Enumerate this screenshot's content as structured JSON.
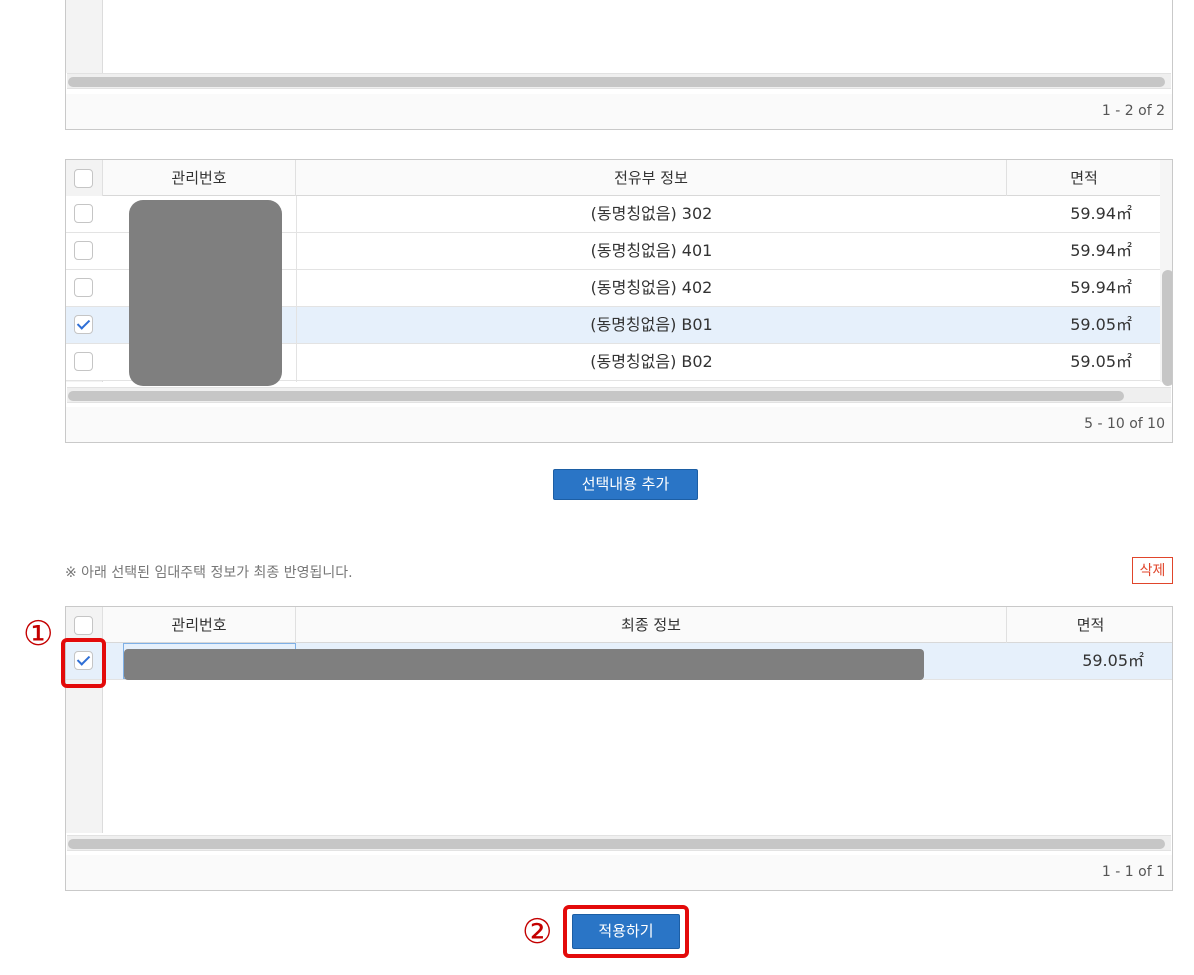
{
  "grid1": {
    "pager": "1 - 2 of 2"
  },
  "grid2": {
    "headers": {
      "id": "관리번호",
      "info": "전유부 정보",
      "area": "면적"
    },
    "rows": [
      {
        "info": "(동명칭없음) 302",
        "area": "59.94㎡",
        "checked": false
      },
      {
        "info": "(동명칭없음) 401",
        "area": "59.94㎡",
        "checked": false
      },
      {
        "info": "(동명칭없음) 402",
        "area": "59.94㎡",
        "checked": false
      },
      {
        "info": "(동명칭없음) B01",
        "area": "59.05㎡",
        "checked": true
      },
      {
        "info": "(동명칭없음) B02",
        "area": "59.05㎡",
        "checked": false
      }
    ],
    "pager": "5 - 10 of 10"
  },
  "add_button": "선택내용 추가",
  "notice": "※ 아래 선택된 임대주택 정보가 최종 반영됩니다.",
  "delete_button": "삭제",
  "grid3": {
    "headers": {
      "id": "관리번호",
      "info": "최종 정보",
      "area": "면적"
    },
    "rows": [
      {
        "area": "59.05㎡",
        "checked": true
      }
    ],
    "pager": "1 - 1 of 1"
  },
  "apply_button": "적용하기",
  "markers": {
    "one": "①",
    "two": "②"
  },
  "colors": {
    "accent": "#2a75c6",
    "highlight": "#e30a0a",
    "selected_row": "#e6f0fb"
  }
}
